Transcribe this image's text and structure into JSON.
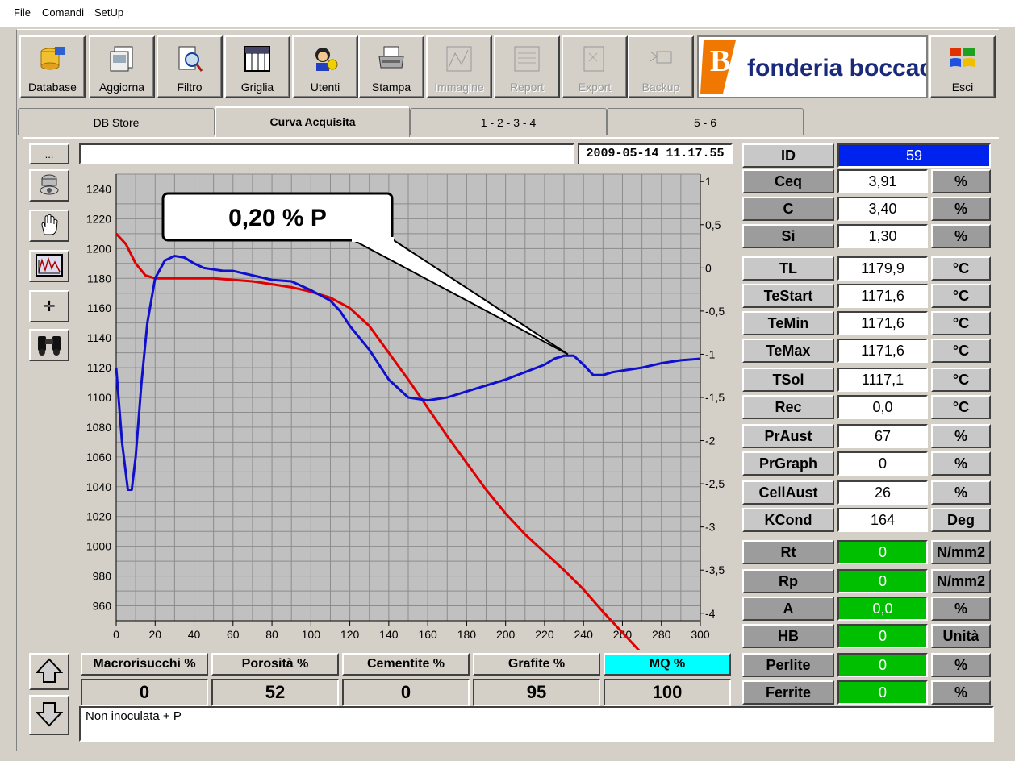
{
  "menu": {
    "file": "File",
    "comandi": "Comandi",
    "setup": "SetUp"
  },
  "toolbar": [
    {
      "label": "Database",
      "icon": "database-icon",
      "enabled": true
    },
    {
      "label": "Aggiorna",
      "icon": "refresh-icon",
      "enabled": true
    },
    {
      "label": "Filtro",
      "icon": "filter-icon",
      "enabled": true
    },
    {
      "label": "Griglia",
      "icon": "grid-icon",
      "enabled": true
    },
    {
      "label": "Utenti",
      "icon": "users-icon",
      "enabled": true
    },
    {
      "label": "Stampa",
      "icon": "printer-icon",
      "enabled": true
    },
    {
      "label": "Immagine",
      "icon": "image-icon",
      "enabled": false
    },
    {
      "label": "Report",
      "icon": "report-icon",
      "enabled": false
    },
    {
      "label": "Export",
      "icon": "export-icon",
      "enabled": false
    },
    {
      "label": "Backup",
      "icon": "backup-icon",
      "enabled": false
    }
  ],
  "logo_text": "fonderia boccacci",
  "esci": "Esci",
  "tabs": [
    "DB Store",
    "Curva Acquisita",
    "1 - 2 - 3 - 4",
    "5 - 6"
  ],
  "side_buttons": {
    "dots": "..."
  },
  "header": {
    "name_value": "",
    "datetime": "2009-05-14 11.17.55"
  },
  "callout": "0,20 % P",
  "params": [
    {
      "label": "ID",
      "value": "59",
      "unit": null,
      "label_style": "light",
      "value_style": "blue"
    },
    {
      "label": "Ceq",
      "value": "3,91",
      "unit": "%",
      "label_style": "dark",
      "value_style": "white"
    },
    {
      "label": "C",
      "value": "3,40",
      "unit": "%",
      "label_style": "dark",
      "value_style": "white"
    },
    {
      "label": "Si",
      "value": "1,30",
      "unit": "%",
      "label_style": "dark",
      "value_style": "white"
    },
    {
      "label": "TL",
      "value": "1179,9",
      "unit": "°C",
      "label_style": "light",
      "value_style": "white"
    },
    {
      "label": "TeStart",
      "value": "1171,6",
      "unit": "°C",
      "label_style": "light",
      "value_style": "white"
    },
    {
      "label": "TeMin",
      "value": "1171,6",
      "unit": "°C",
      "label_style": "light",
      "value_style": "white"
    },
    {
      "label": "TeMax",
      "value": "1171,6",
      "unit": "°C",
      "label_style": "light",
      "value_style": "white"
    },
    {
      "label": "TSol",
      "value": "1117,1",
      "unit": "°C",
      "label_style": "light",
      "value_style": "white"
    },
    {
      "label": "Rec",
      "value": "0,0",
      "unit": "°C",
      "label_style": "light",
      "value_style": "white"
    },
    {
      "label": "PrAust",
      "value": "67",
      "unit": "%",
      "label_style": "light",
      "value_style": "white"
    },
    {
      "label": "PrGraph",
      "value": "0",
      "unit": "%",
      "label_style": "light",
      "value_style": "white"
    },
    {
      "label": "CellAust",
      "value": "26",
      "unit": "%",
      "label_style": "light",
      "value_style": "white"
    },
    {
      "label": "KCond",
      "value": "164",
      "unit": "Deg",
      "label_style": "light",
      "value_style": "white"
    },
    {
      "label": "Rt",
      "value": "0",
      "unit": "N/mm2",
      "label_style": "dark",
      "value_style": "green"
    },
    {
      "label": "Rp",
      "value": "0",
      "unit": "N/mm2",
      "label_style": "dark",
      "value_style": "green"
    },
    {
      "label": "A",
      "value": "0,0",
      "unit": "%",
      "label_style": "dark",
      "value_style": "green"
    },
    {
      "label": "HB",
      "value": "0",
      "unit": "Unità",
      "label_style": "dark",
      "value_style": "green"
    },
    {
      "label": "Perlite",
      "value": "0",
      "unit": "%",
      "label_style": "dark",
      "value_style": "green"
    },
    {
      "label": "Ferrite",
      "value": "0",
      "unit": "%",
      "label_style": "dark",
      "value_style": "green"
    }
  ],
  "bottom": [
    {
      "label": "Macrorisucchi %",
      "value": "0",
      "highlight": false
    },
    {
      "label": "Porosità %",
      "value": "52",
      "highlight": false
    },
    {
      "label": "Cementite %",
      "value": "0",
      "highlight": false
    },
    {
      "label": "Grafite %",
      "value": "95",
      "highlight": false
    },
    {
      "label": "MQ %",
      "value": "100",
      "highlight": true
    }
  ],
  "notes": "Non inoculata + P",
  "colors": {
    "temp_curve": "#e00000",
    "deriv_curve": "#1010cc",
    "plot_bg": "#c0c0c0",
    "grid": "#8c8c8c",
    "mq_highlight": "#00ffff",
    "id_bg": "#0022ee",
    "green": "#00bf00"
  },
  "chart_data": {
    "type": "line",
    "x_ticks": [
      0,
      20,
      40,
      60,
      80,
      100,
      120,
      140,
      160,
      180,
      200,
      220,
      240,
      260,
      280,
      300
    ],
    "y_left_ticks": [
      960,
      980,
      1000,
      1020,
      1040,
      1060,
      1080,
      1100,
      1120,
      1140,
      1160,
      1180,
      1200,
      1220,
      1240
    ],
    "y_right_ticks": [
      "-4",
      "-3,5",
      "-3",
      "-2,5",
      "-2",
      "-1,5",
      "-1",
      "-0,5",
      "0",
      "0,5",
      "1"
    ],
    "xlim": [
      0,
      300
    ],
    "ylim_left": [
      950,
      1250
    ],
    "ylim_right": [
      -4,
      1
    ],
    "series": [
      {
        "axis": "left",
        "color": "red",
        "x": [
          0,
          5,
          10,
          15,
          20,
          30,
          40,
          50,
          60,
          70,
          80,
          90,
          100,
          110,
          120,
          130,
          140,
          150,
          160,
          170,
          180,
          190,
          200,
          210,
          220,
          230,
          240,
          250,
          260,
          270,
          280,
          288
        ],
        "y": [
          1210,
          1203,
          1190,
          1182,
          1180,
          1180,
          1180,
          1180,
          1179,
          1178,
          1176,
          1174,
          1171,
          1167,
          1160,
          1148,
          1130,
          1112,
          1093,
          1074,
          1056,
          1038,
          1022,
          1008,
          996,
          984,
          971,
          956,
          942,
          928,
          914,
          905
        ]
      },
      {
        "axis": "left",
        "color": "blue",
        "x": [
          0,
          3,
          6,
          8,
          10,
          13,
          16,
          20,
          25,
          30,
          35,
          40,
          45,
          50,
          55,
          60,
          70,
          80,
          90,
          100,
          110,
          115,
          120,
          130,
          140,
          150,
          160,
          170,
          180,
          190,
          200,
          210,
          220,
          225,
          230,
          235,
          240,
          245,
          250,
          255,
          260,
          270,
          280,
          290,
          300
        ],
        "y": [
          1120,
          1070,
          1038,
          1038,
          1060,
          1110,
          1150,
          1180,
          1192,
          1195,
          1194,
          1190,
          1187,
          1186,
          1185,
          1185,
          1182,
          1179,
          1178,
          1172,
          1165,
          1158,
          1148,
          1132,
          1112,
          1100,
          1098,
          1100,
          1104,
          1108,
          1112,
          1117,
          1122,
          1126,
          1128,
          1128,
          1122,
          1115,
          1115,
          1117,
          1118,
          1120,
          1123,
          1125,
          1126
        ]
      }
    ]
  }
}
